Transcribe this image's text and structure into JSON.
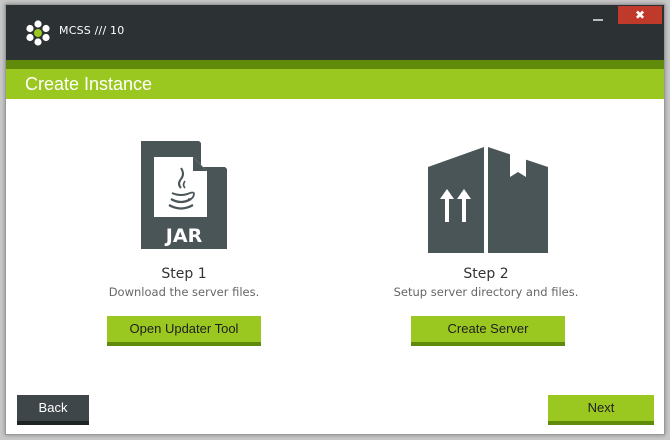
{
  "window": {
    "app_title": "MCSS /// 10",
    "minimize_symbol": "",
    "close_symbol": "✖"
  },
  "header": {
    "title": "Create Instance"
  },
  "steps": [
    {
      "icon": "jar-file-icon",
      "badge": "JAR",
      "title": "Step 1",
      "description": "Download the server files.",
      "button_label": "Open Updater Tool"
    },
    {
      "icon": "box-upload-icon",
      "title": "Step 2",
      "description": "Setup server directory and files.",
      "button_label": "Create Server"
    }
  ],
  "footer": {
    "back_label": "Back",
    "next_label": "Next"
  },
  "colors": {
    "titlebar": "#2c3133",
    "accent_green": "#9bc820",
    "dark_green": "#5f8a0a",
    "close_red": "#c03a2b",
    "icon_slate": "#4a5558"
  }
}
